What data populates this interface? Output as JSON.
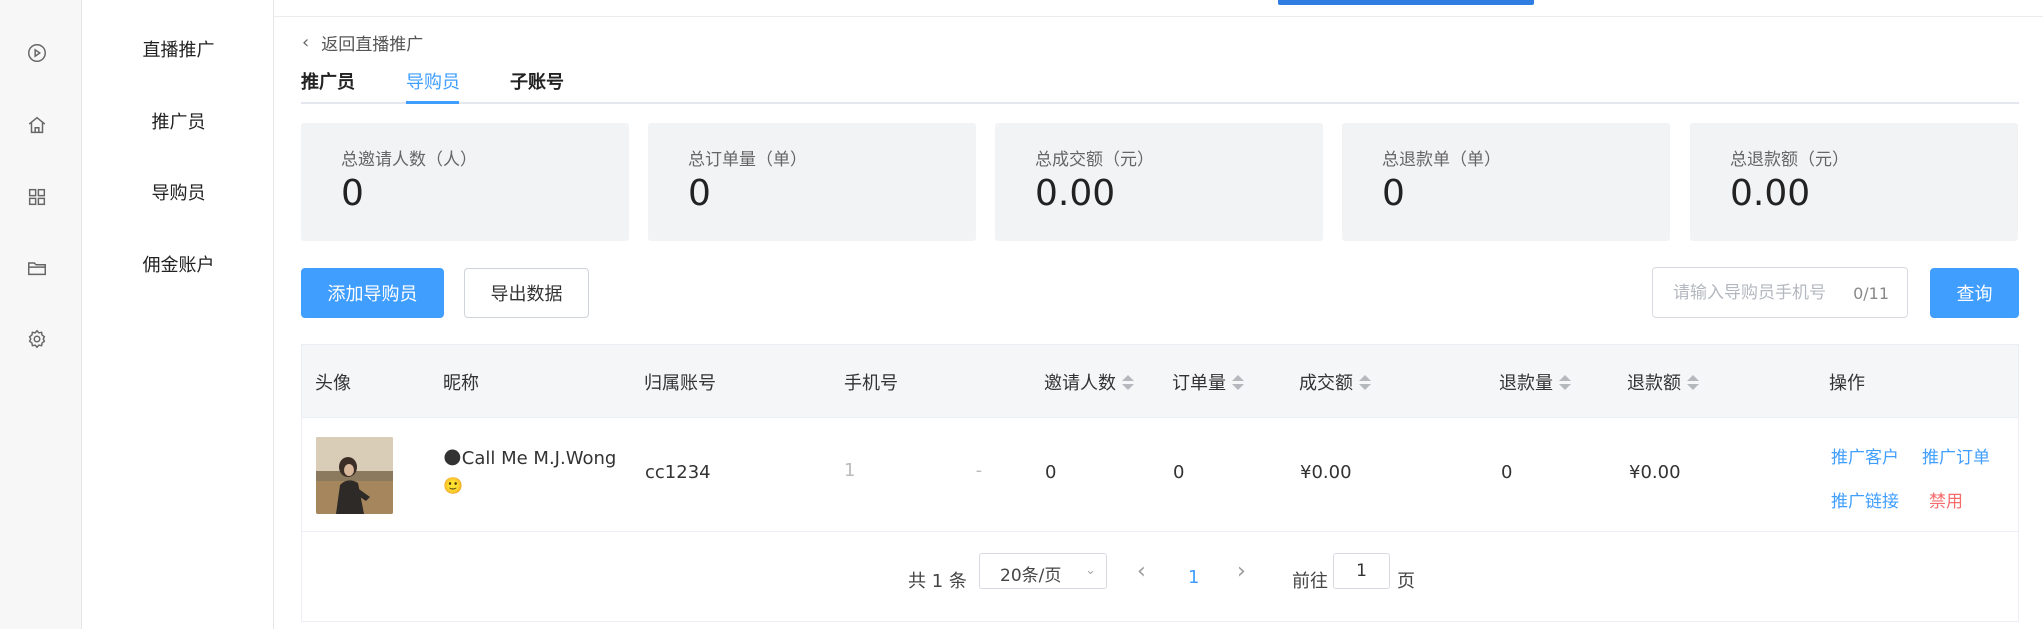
{
  "rail": {
    "icons": [
      "play-circle-icon",
      "home-icon",
      "grid-icon",
      "folder-icon",
      "gear-icon"
    ]
  },
  "submenu": {
    "items": [
      {
        "label": "直播推广"
      },
      {
        "label": "推广员"
      },
      {
        "label": "导购员"
      },
      {
        "label": "佣金账户"
      }
    ]
  },
  "back": {
    "label": "返回直播推广"
  },
  "tabs": [
    {
      "label": "推广员"
    },
    {
      "label": "导购员"
    },
    {
      "label": "子账号"
    }
  ],
  "stats": [
    {
      "label": "总邀请人数（人）",
      "value": "0"
    },
    {
      "label": "总订单量（单）",
      "value": "0"
    },
    {
      "label": "总成交额（元）",
      "value": "0.00"
    },
    {
      "label": "总退款单（单）",
      "value": "0"
    },
    {
      "label": "总退款额（元）",
      "value": "0.00"
    }
  ],
  "toolbar": {
    "add_label": "添加导购员",
    "export_label": "导出数据",
    "query_label": "查询"
  },
  "search": {
    "placeholder": "请输入导购员手机号",
    "counter": "0/11"
  },
  "table": {
    "columns": [
      "头像",
      "昵称",
      "归属账号",
      "手机号",
      "邀请人数",
      "订单量",
      "成交额",
      "退款量",
      "退款额",
      "操作"
    ],
    "rows": [
      {
        "nickname_line1": "🌑Call Me M.J.Wong",
        "nickname_line2": "🙂",
        "account": "cc1234",
        "phone": "1                     -",
        "invites": "0",
        "orders": "0",
        "amount": "¥0.00",
        "refunds": "0",
        "refund_amount": "¥0.00",
        "actions": [
          "推广客户",
          "推广订单",
          "推广链接",
          "禁用"
        ]
      }
    ]
  },
  "pagination": {
    "total": "共 1 条",
    "page_size": "20条/页",
    "current": "1",
    "goto": "前往",
    "goto_value": "1",
    "unit": "页"
  },
  "colors": {
    "primary": "#409eff",
    "danger": "#f56c6c",
    "card_bg": "#f2f3f5"
  }
}
